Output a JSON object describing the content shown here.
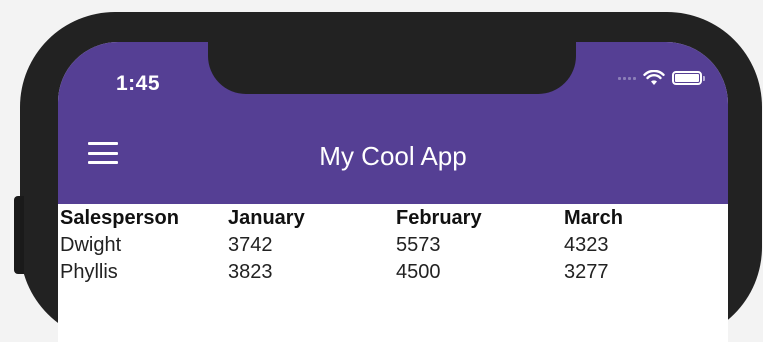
{
  "status_bar": {
    "time": "1:45"
  },
  "app_bar": {
    "title": "My Cool App",
    "menu_icon": "hamburger-menu-icon"
  },
  "table": {
    "headers": [
      "Salesperson",
      "January",
      "February",
      "March"
    ],
    "rows": [
      [
        "Dwight",
        "3742",
        "5573",
        "4323"
      ],
      [
        "Phyllis",
        "3823",
        "4500",
        "3277"
      ]
    ]
  },
  "colors": {
    "app_bar": "#553f94",
    "frame": "#222222",
    "screen": "#ffffff"
  }
}
